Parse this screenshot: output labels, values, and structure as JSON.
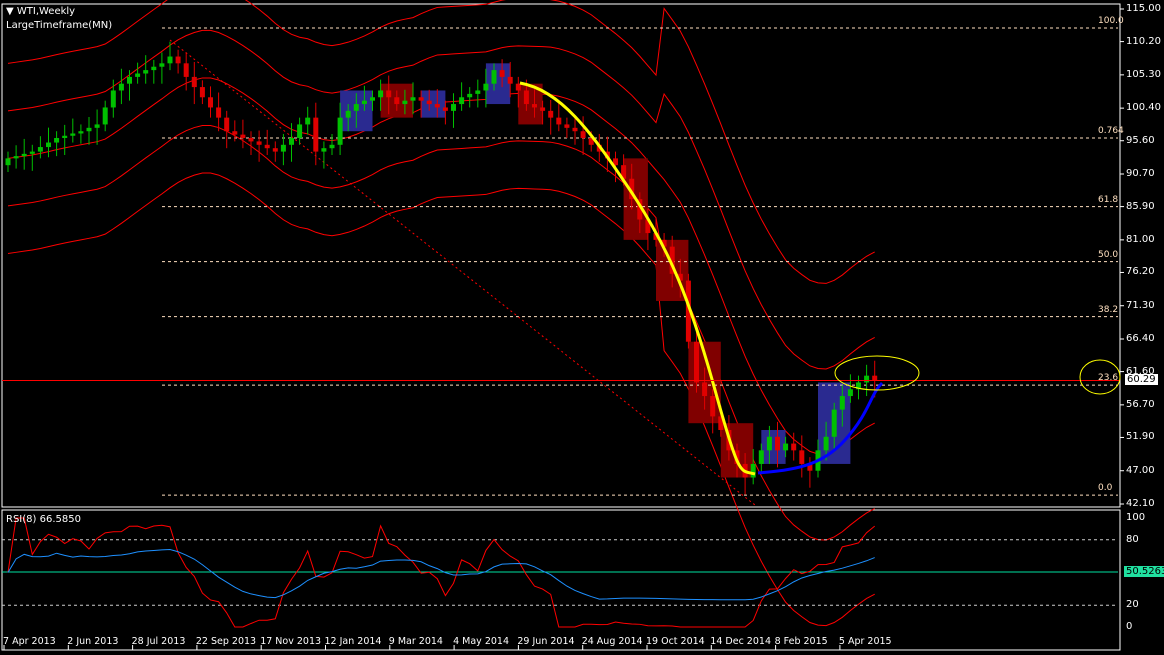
{
  "header": {
    "symbol_title": "WTI,Weekly",
    "indicator": "LargeTimeframe(MN)"
  },
  "rsi": {
    "label": "RSI(8) 66.5850",
    "levels": [
      80,
      20
    ],
    "mid_value": "50.5263",
    "axis_labels": [
      "100",
      "80",
      "20",
      "0"
    ]
  },
  "price_axis": [
    "115.00",
    "110.20",
    "105.30",
    "100.40",
    "95.60",
    "90.70",
    "85.90",
    "81.00",
    "76.20",
    "71.30",
    "66.40",
    "61.60",
    "56.70",
    "51.90",
    "47.00",
    "42.10"
  ],
  "current_price": "60.29",
  "fibonacci": {
    "levels": [
      {
        "label": "100.0",
        "price": 112.2
      },
      {
        "label": "0.764",
        "price": 96.0
      },
      {
        "label": "61.8",
        "price": 85.9
      },
      {
        "label": "50.0",
        "price": 77.8
      },
      {
        "label": "38.2",
        "price": 69.7
      },
      {
        "label": "23.6",
        "price": 59.6
      },
      {
        "label": "0.0",
        "price": 43.4
      }
    ]
  },
  "time_axis": [
    "7 Apr 2013",
    "2 Jun 2013",
    "28 Jul 2013",
    "22 Sep 2013",
    "17 Nov 2013",
    "12 Jan 2014",
    "9 Mar 2014",
    "4 May 2014",
    "29 Jun 2014",
    "24 Aug 2014",
    "19 Oct 2014",
    "14 Dec 2014",
    "8 Feb 2015",
    "5 Apr 2015"
  ],
  "colors": {
    "bull": "#00c000",
    "bear": "#e00000",
    "band": "#ff0000",
    "fib": "#ffe0c0",
    "trend_down": "#ffff00",
    "trend_up": "#0000ff",
    "rsi": "#ff0000",
    "rsi2": "#1e90ff",
    "mid": "#00e0a0"
  },
  "chart_data": {
    "type": "candlestick",
    "title": "WTI,Weekly",
    "ylim": [
      42.1,
      115.0
    ],
    "close_anchors": [
      [
        0,
        93
      ],
      [
        3,
        94
      ],
      [
        6,
        96
      ],
      [
        9,
        97
      ],
      [
        11,
        98
      ],
      [
        13,
        103
      ],
      [
        15,
        105
      ],
      [
        17,
        106
      ],
      [
        19,
        107
      ],
      [
        20,
        108
      ],
      [
        21,
        107
      ],
      [
        22,
        105
      ],
      [
        24,
        102
      ],
      [
        26,
        99
      ],
      [
        27,
        97
      ],
      [
        29,
        96
      ],
      [
        31,
        95
      ],
      [
        33,
        94
      ],
      [
        35,
        96
      ],
      [
        36,
        98
      ],
      [
        37,
        99
      ],
      [
        38,
        94
      ],
      [
        40,
        95
      ],
      [
        41,
        99
      ],
      [
        43,
        101
      ],
      [
        45,
        102
      ],
      [
        46,
        103
      ],
      [
        48,
        101
      ],
      [
        50,
        102
      ],
      [
        52,
        101
      ],
      [
        54,
        100
      ],
      [
        56,
        102
      ],
      [
        58,
        103
      ],
      [
        59,
        104
      ],
      [
        60,
        106
      ],
      [
        61,
        105
      ],
      [
        62,
        104
      ],
      [
        63,
        103
      ],
      [
        64,
        101
      ],
      [
        66,
        100
      ],
      [
        68,
        98
      ],
      [
        70,
        97
      ],
      [
        72,
        95
      ],
      [
        74,
        93
      ],
      [
        75,
        92
      ],
      [
        76,
        90
      ],
      [
        77,
        87
      ],
      [
        78,
        84
      ],
      [
        79,
        82
      ],
      [
        80,
        81
      ],
      [
        81,
        80
      ],
      [
        82,
        76
      ],
      [
        83,
        75
      ],
      [
        84,
        66
      ],
      [
        85,
        60
      ],
      [
        86,
        58
      ],
      [
        87,
        55
      ],
      [
        88,
        53
      ],
      [
        89,
        50
      ],
      [
        90,
        48
      ],
      [
        91,
        46
      ],
      [
        92,
        48
      ],
      [
        93,
        50
      ],
      [
        94,
        52
      ],
      [
        95,
        50
      ],
      [
        96,
        51
      ],
      [
        97,
        50
      ],
      [
        98,
        48
      ],
      [
        99,
        47
      ],
      [
        100,
        50
      ],
      [
        101,
        52
      ],
      [
        102,
        56
      ],
      [
        103,
        58
      ],
      [
        104,
        59
      ],
      [
        105,
        60
      ],
      [
        106,
        61
      ],
      [
        107,
        60.29
      ]
    ]
  }
}
